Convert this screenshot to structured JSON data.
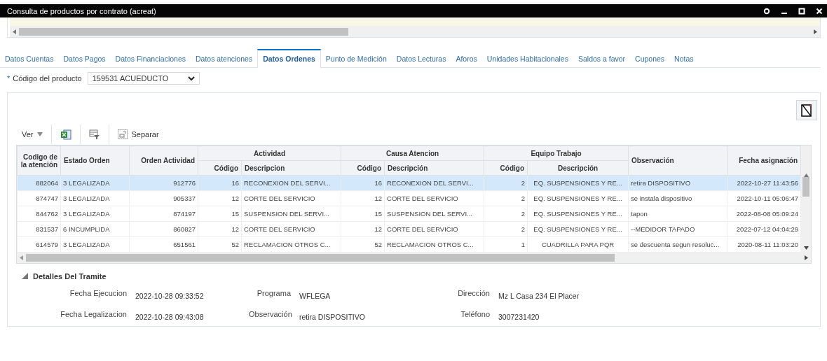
{
  "window": {
    "title": "Consulta de productos por contrato (acreat)"
  },
  "tabs": [
    {
      "label": "Datos Cuentas",
      "selected": false
    },
    {
      "label": "Datos Pagos",
      "selected": false
    },
    {
      "label": "Datos Financiaciones",
      "selected": false
    },
    {
      "label": "Datos atenciones",
      "selected": false
    },
    {
      "label": "Datos Ordenes",
      "selected": true
    },
    {
      "label": "Punto de Medición",
      "selected": false
    },
    {
      "label": "Datos Lecturas",
      "selected": false
    },
    {
      "label": "Aforos",
      "selected": false
    },
    {
      "label": "Unidades Habitacionales",
      "selected": false
    },
    {
      "label": "Saldos a favor",
      "selected": false
    },
    {
      "label": "Cupones",
      "selected": false
    },
    {
      "label": "Notas",
      "selected": false
    }
  ],
  "product_field": {
    "required_mark": "*",
    "label": "Código del producto",
    "value": "159531 ACUEDUCTO"
  },
  "toolbar": {
    "view_menu": "Ver",
    "detach": "Separar"
  },
  "table": {
    "column_groups": [
      {
        "label": "Codigo de la atención"
      },
      {
        "label": "Estado Orden"
      },
      {
        "label": "Orden Actividad"
      },
      {
        "label": "Actividad",
        "sub_columns": [
          "Código",
          "Descripcion"
        ]
      },
      {
        "label": "Causa Atencion",
        "sub_columns": [
          "Código",
          "Descripción"
        ]
      },
      {
        "label": "Equipo Trabajo",
        "sub_columns": [
          "Código",
          "Descripción"
        ]
      },
      {
        "label": "Observación"
      },
      {
        "label": "Fecha asignación"
      }
    ],
    "rows": [
      {
        "selected": true,
        "cells": [
          "882064",
          "3 LEGALIZADA",
          "912776",
          "16",
          "RECONEXION DEL SERVI...",
          "16",
          "RECONEXION DEL SERVI...",
          "2",
          "EQ. SUSPENSIONES Y RE...",
          "retira DISPOSITIVO",
          "2022-10-27 11:43:56"
        ]
      },
      {
        "selected": false,
        "cells": [
          "874747",
          "3 LEGALIZADA",
          "905337",
          "12",
          "CORTE DEL SERVICIO",
          "12",
          "CORTE DEL SERVICIO",
          "2",
          "EQ. SUSPENSIONES Y RE...",
          "se instala dispositivo",
          "2022-10-11 05:06:47"
        ]
      },
      {
        "selected": false,
        "cells": [
          "844762",
          "3 LEGALIZADA",
          "874197",
          "15",
          "SUSPENSION DEL SERVI...",
          "15",
          "SUSPENSION DEL SERVI...",
          "2",
          "EQ. SUSPENSIONES Y RE...",
          "tapon",
          "2022-08-08 05:09:24"
        ]
      },
      {
        "selected": false,
        "cells": [
          "831537",
          "6 INCUMPLIDA",
          "860827",
          "12",
          "CORTE DEL SERVICIO",
          "12",
          "CORTE DEL SERVICIO",
          "2",
          "EQ. SUSPENSIONES Y RE...",
          "--MEDIDOR TAPADO",
          "2022-07-12 04:04:29"
        ]
      },
      {
        "selected": false,
        "cells": [
          "614579",
          "3 LEGALIZADA",
          "651561",
          "52",
          "RECLAMACION OTROS C...",
          "52",
          "RECLAMACION OTROS C...",
          "1",
          "CUADRILLA PARA PQR",
          "se descuenta segun resoluc...",
          "2020-08-11 11:03:20"
        ]
      }
    ]
  },
  "details": {
    "title": "Detalles Del Tramite",
    "expanded": true,
    "fields": [
      {
        "label": "Fecha Ejecucion",
        "value": "2022-10-28 09:33:52"
      },
      {
        "label": "Programa",
        "value": "WFLEGA"
      },
      {
        "label": "Dirección",
        "value": "Mz L Casa 234 El Placer"
      },
      {
        "label": "Fecha Legalizacion",
        "value": "2022-10-28 09:43:08"
      },
      {
        "label": "Observación",
        "value": "retira DISPOSITIVO"
      },
      {
        "label": "Teléfono",
        "value": "3007231420"
      }
    ]
  }
}
